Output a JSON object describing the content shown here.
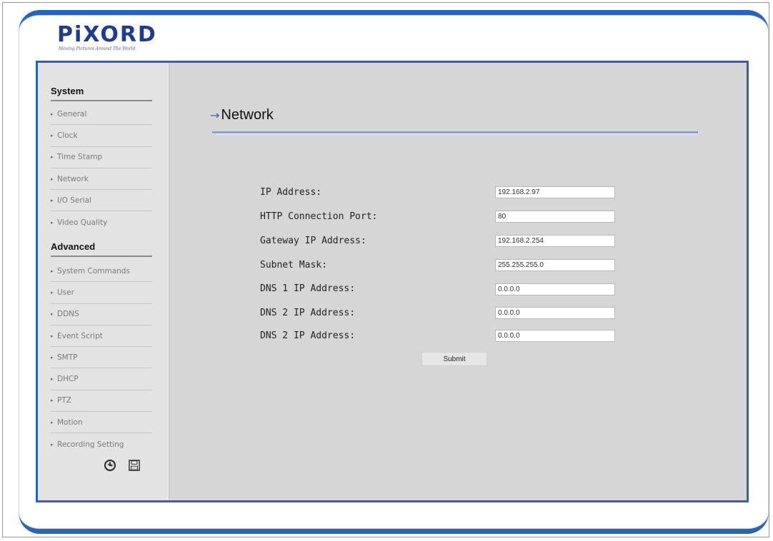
{
  "brand": {
    "name": "PiXORD",
    "tagline": "Moving Pictures Around The World"
  },
  "sidebar": {
    "system_heading": "System",
    "system_items": [
      {
        "label": "General"
      },
      {
        "label": "Clock"
      },
      {
        "label": "Time Stamp"
      },
      {
        "label": "Network"
      },
      {
        "label": "I/O Serial"
      },
      {
        "label": "Video Quality"
      }
    ],
    "advanced_heading": "Advanced",
    "advanced_items": [
      {
        "label": "System Commands"
      },
      {
        "label": "User"
      },
      {
        "label": "DDNS"
      },
      {
        "label": "Event Script"
      },
      {
        "label": "SMTP"
      },
      {
        "label": "DHCP"
      },
      {
        "label": "PTZ"
      },
      {
        "label": "Motion"
      },
      {
        "label": "Recording Setting"
      }
    ],
    "icons": [
      "refresh-icon",
      "save-icon"
    ]
  },
  "main": {
    "title": "Network",
    "fields": [
      {
        "label": "IP Address:",
        "value": "192.168.2.97"
      },
      {
        "label": "HTTP Connection Port:",
        "value": "80"
      },
      {
        "label": "Gateway IP Address:",
        "value": "192.168.2.254"
      },
      {
        "label": "Subnet Mask:",
        "value": "255.255.255.0"
      },
      {
        "label": "DNS 1 IP Address:",
        "value": "0.0.0.0"
      },
      {
        "label": "DNS 2 IP Address:",
        "value": "0.0.0.0"
      },
      {
        "label": "DNS 2 IP Address:",
        "value": "0.0.0.0"
      }
    ],
    "submit_label": "Submit"
  },
  "colors": {
    "frame_blue": "#2a63b8",
    "brand_navy": "#1f3d8a",
    "panel_gray": "#d6d6d6"
  }
}
